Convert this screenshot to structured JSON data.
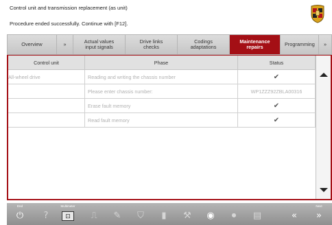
{
  "header": {
    "title": "Control unit and transmission replacement (as unit)",
    "status": "Procedure ended successfully. Continue with [F12]."
  },
  "tabs": [
    {
      "label": "Overview"
    },
    {
      "label": "»"
    },
    {
      "label": "Actual values\ninput signals"
    },
    {
      "label": "Drive links\nchecks"
    },
    {
      "label": "Codings\nadaptations"
    },
    {
      "label": "Maintenance\nrepairs",
      "active": true
    },
    {
      "label": "Programming"
    },
    {
      "label": "»"
    }
  ],
  "table": {
    "columns": [
      "Control unit",
      "Phase",
      "Status"
    ],
    "rows": [
      {
        "unit": "All-wheel drive",
        "phase": "Reading and writing the chassis number",
        "status": "✔"
      },
      {
        "unit": "",
        "phase": "Please enter chassis number:",
        "status": "WP1ZZZ92ZBLA00316"
      },
      {
        "unit": "",
        "phase": "Erase fault memory",
        "status": "✔"
      },
      {
        "unit": "",
        "phase": "Read fault memory",
        "status": "✔"
      }
    ]
  },
  "toolbar": {
    "end_label": "End",
    "multimeter_label": "Multimeter",
    "next_label": "Next"
  },
  "colors": {
    "accent": "#a40f15",
    "toolbar": "#9e9e9e"
  }
}
